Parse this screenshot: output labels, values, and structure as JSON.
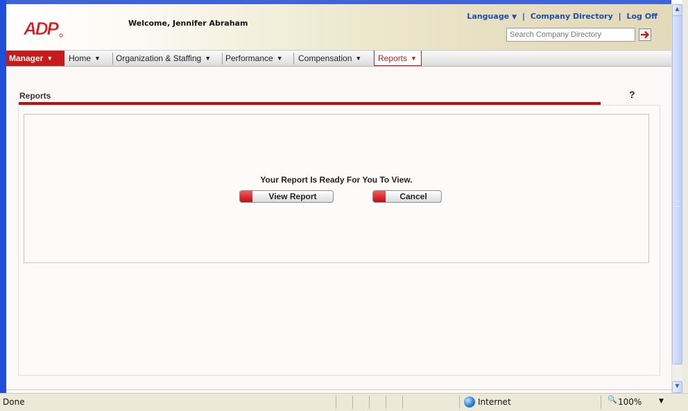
{
  "header": {
    "welcome": "Welcome, Jennifer Abraham",
    "language_label": "Language",
    "company_directory_label": "Company Directory",
    "logoff_label": "Log Off",
    "separator": "|",
    "search_placeholder": "Search Company Directory"
  },
  "menu": {
    "manager": "Manager",
    "home": "Home",
    "organization": "Organization & Staffing",
    "performance": "Performance",
    "compensation": "Compensation",
    "reports": "Reports"
  },
  "page": {
    "title": "Reports",
    "help": "?",
    "message": "Your Report Is Ready For You To View.",
    "view_report_label": "View Report",
    "cancel_label": "Cancel"
  },
  "statusbar": {
    "status": "Done",
    "zone": "Internet",
    "zoom": "100%"
  },
  "colors": {
    "accent_red": "#c71a1a",
    "link_blue": "#1d4ea6",
    "frame_blue": "#1f4ed8"
  }
}
